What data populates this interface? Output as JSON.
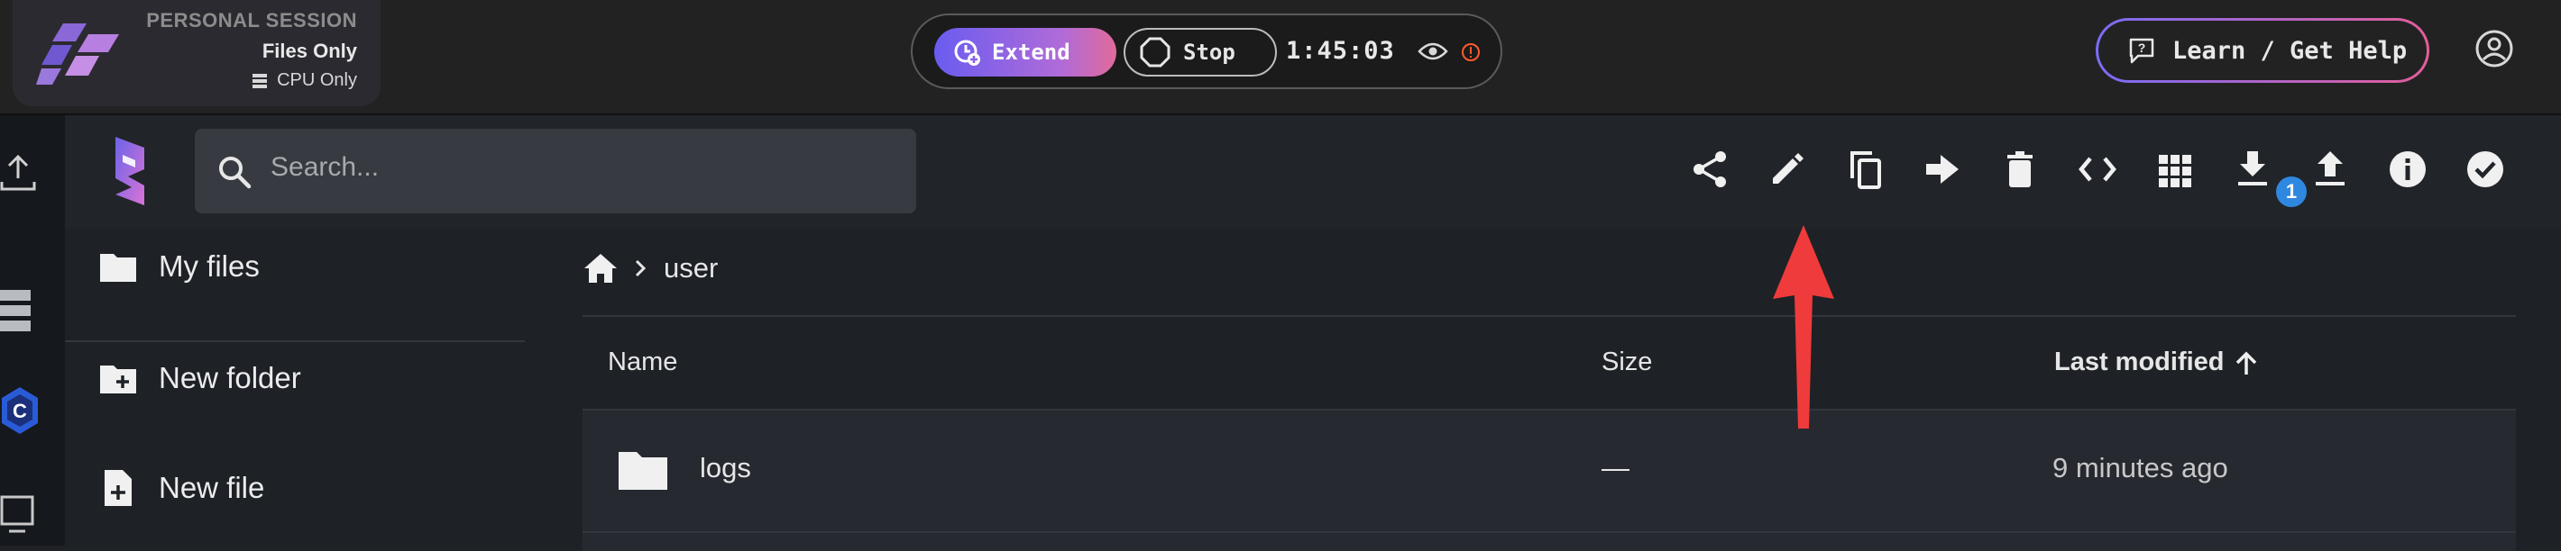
{
  "session": {
    "type_label": "PERSONAL SESSION",
    "mode_label": "Files Only",
    "compute_label": "CPU Only",
    "extend_label": "Extend",
    "stop_label": "Stop",
    "timer": "1:45:03",
    "help_label": "Learn / Get Help"
  },
  "search": {
    "placeholder": "Search..."
  },
  "toolbar": {
    "icons": [
      "share-icon",
      "edit-icon",
      "copy-icon",
      "move-icon",
      "delete-icon",
      "embed-code-icon",
      "grid-view-icon",
      "download-icon",
      "upload-icon",
      "info-icon",
      "select-all-icon"
    ],
    "download_badge": "1"
  },
  "sidebar": {
    "items": [
      {
        "label": "My files",
        "icon": "folder-icon"
      },
      {
        "label": "New folder",
        "icon": "create-folder-icon"
      },
      {
        "label": "New file",
        "icon": "create-file-icon"
      }
    ]
  },
  "breadcrumb": {
    "current": "user"
  },
  "table": {
    "columns": {
      "name": "Name",
      "size": "Size",
      "modified": "Last modified"
    },
    "sort": {
      "column": "modified",
      "direction": "ascending"
    },
    "rows": [
      {
        "name": "logs",
        "size": "—",
        "modified": "9 minutes ago",
        "type": "folder"
      }
    ]
  },
  "colors": {
    "accent_gradient_start": "#6a5cf0",
    "accent_gradient_end": "#e16a9b",
    "annotation_arrow": "#ef3b3b",
    "badge": "#2f88e0"
  }
}
